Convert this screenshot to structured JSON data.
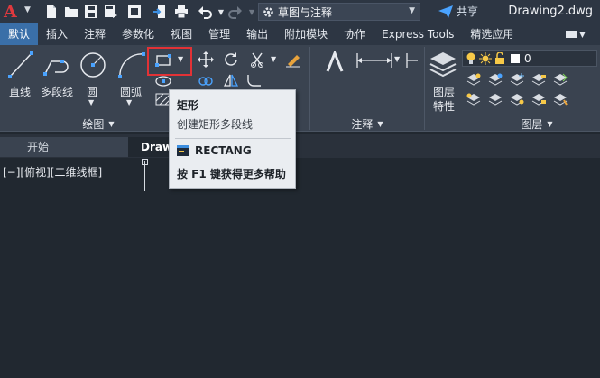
{
  "app": {
    "logo_letter": "A",
    "workspace": "草图与注释",
    "share_label": "共享",
    "document_title": "Drawing2.dwg"
  },
  "ribbon_tabs": [
    "默认",
    "插入",
    "注释",
    "参数化",
    "视图",
    "管理",
    "输出",
    "附加模块",
    "协作",
    "Express Tools",
    "精选应用"
  ],
  "active_tab": "默认",
  "draw_panel": {
    "line": "直线",
    "polyline": "多段线",
    "circle": "圆",
    "arc": "圆弧",
    "footer": "绘图"
  },
  "annotation_panel": {
    "footer": "注释"
  },
  "layers_panel": {
    "layer_properties_line1": "图层",
    "layer_properties_line2": "特性",
    "current_layer": "0",
    "footer": "图层"
  },
  "file_tabs": {
    "start": "开始",
    "document": "Draw"
  },
  "viewport": {
    "label": "[−][俯视][二维线框]"
  },
  "tooltip": {
    "title": "矩形",
    "description": "创建矩形多段线",
    "command": "RECTANG",
    "help_text": "按 F1 键获得更多帮助"
  },
  "colors": {
    "accent_tab": "#3a6fa8",
    "highlight": "#e23236",
    "background": "#212830",
    "ribbon": "#3a4350"
  }
}
